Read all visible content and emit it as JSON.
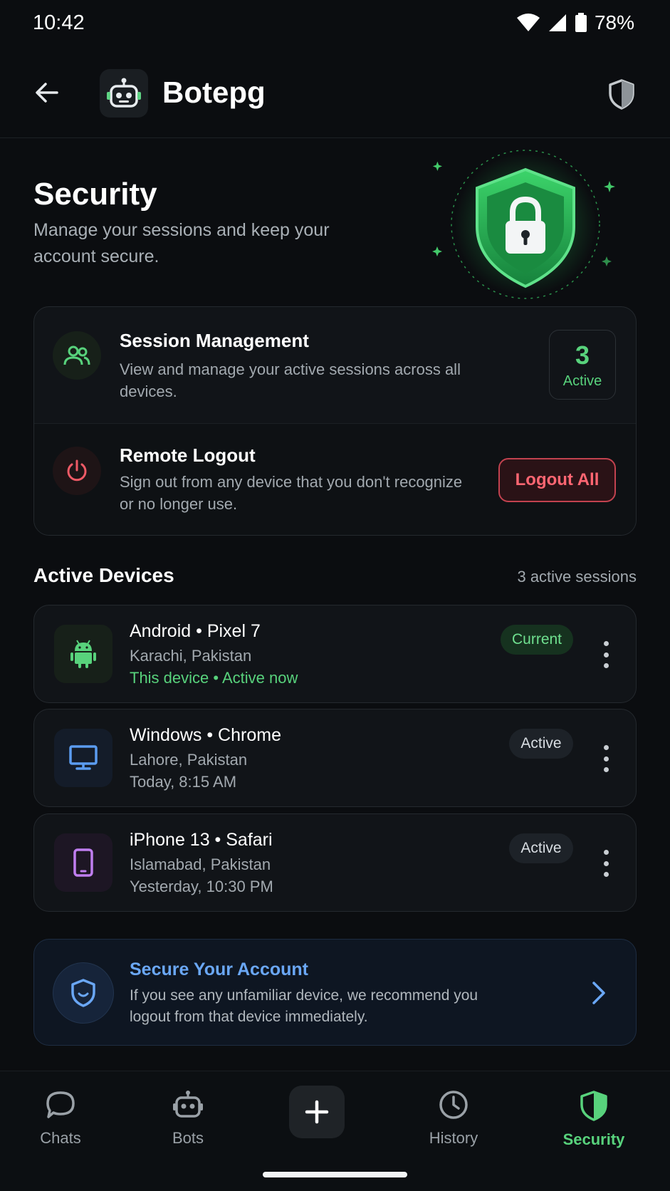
{
  "status_bar": {
    "time": "10:42",
    "battery": "78%"
  },
  "app_bar": {
    "title": "Botepg"
  },
  "hero": {
    "title": "Security",
    "subtitle": "Manage your sessions and keep your account secure."
  },
  "session_card": {
    "title": "Session Management",
    "description": "View and manage your active sessions across all devices.",
    "count": "3",
    "count_label": "Active"
  },
  "remote_card": {
    "title": "Remote Logout",
    "description": "Sign out from any device that you don't recognize or no longer use.",
    "button_label": "Logout All"
  },
  "devices_section": {
    "title": "Active Devices",
    "count_text": "3 active sessions"
  },
  "devices": [
    {
      "name": "Android • Pixel 7",
      "location": "Karachi, Pakistan",
      "detail": "This device • Active now",
      "badge": "Current",
      "icon": "android-icon"
    },
    {
      "name": "Windows • Chrome",
      "location": "Lahore, Pakistan",
      "detail": "Today, 8:15 AM",
      "badge": "Active",
      "icon": "monitor-icon"
    },
    {
      "name": "iPhone 13 • Safari",
      "location": "Islamabad, Pakistan",
      "detail": "Yesterday, 10:30 PM",
      "badge": "Active",
      "icon": "phone-icon"
    }
  ],
  "secure_banner": {
    "title": "Secure Your Account",
    "description": "If you see any unfamiliar device, we recommend you logout from that device immediately."
  },
  "bottom_nav": {
    "items": [
      {
        "label": "Chats",
        "icon": "chat-icon"
      },
      {
        "label": "Bots",
        "icon": "bot-icon"
      },
      {
        "label": "History",
        "icon": "history-icon"
      },
      {
        "label": "Security",
        "icon": "shield-icon",
        "active": true
      }
    ]
  },
  "colors": {
    "background": "#0b0d10",
    "accent_green": "#58d27c",
    "danger_red": "#ff6672",
    "link_blue": "#6aa7f5"
  }
}
